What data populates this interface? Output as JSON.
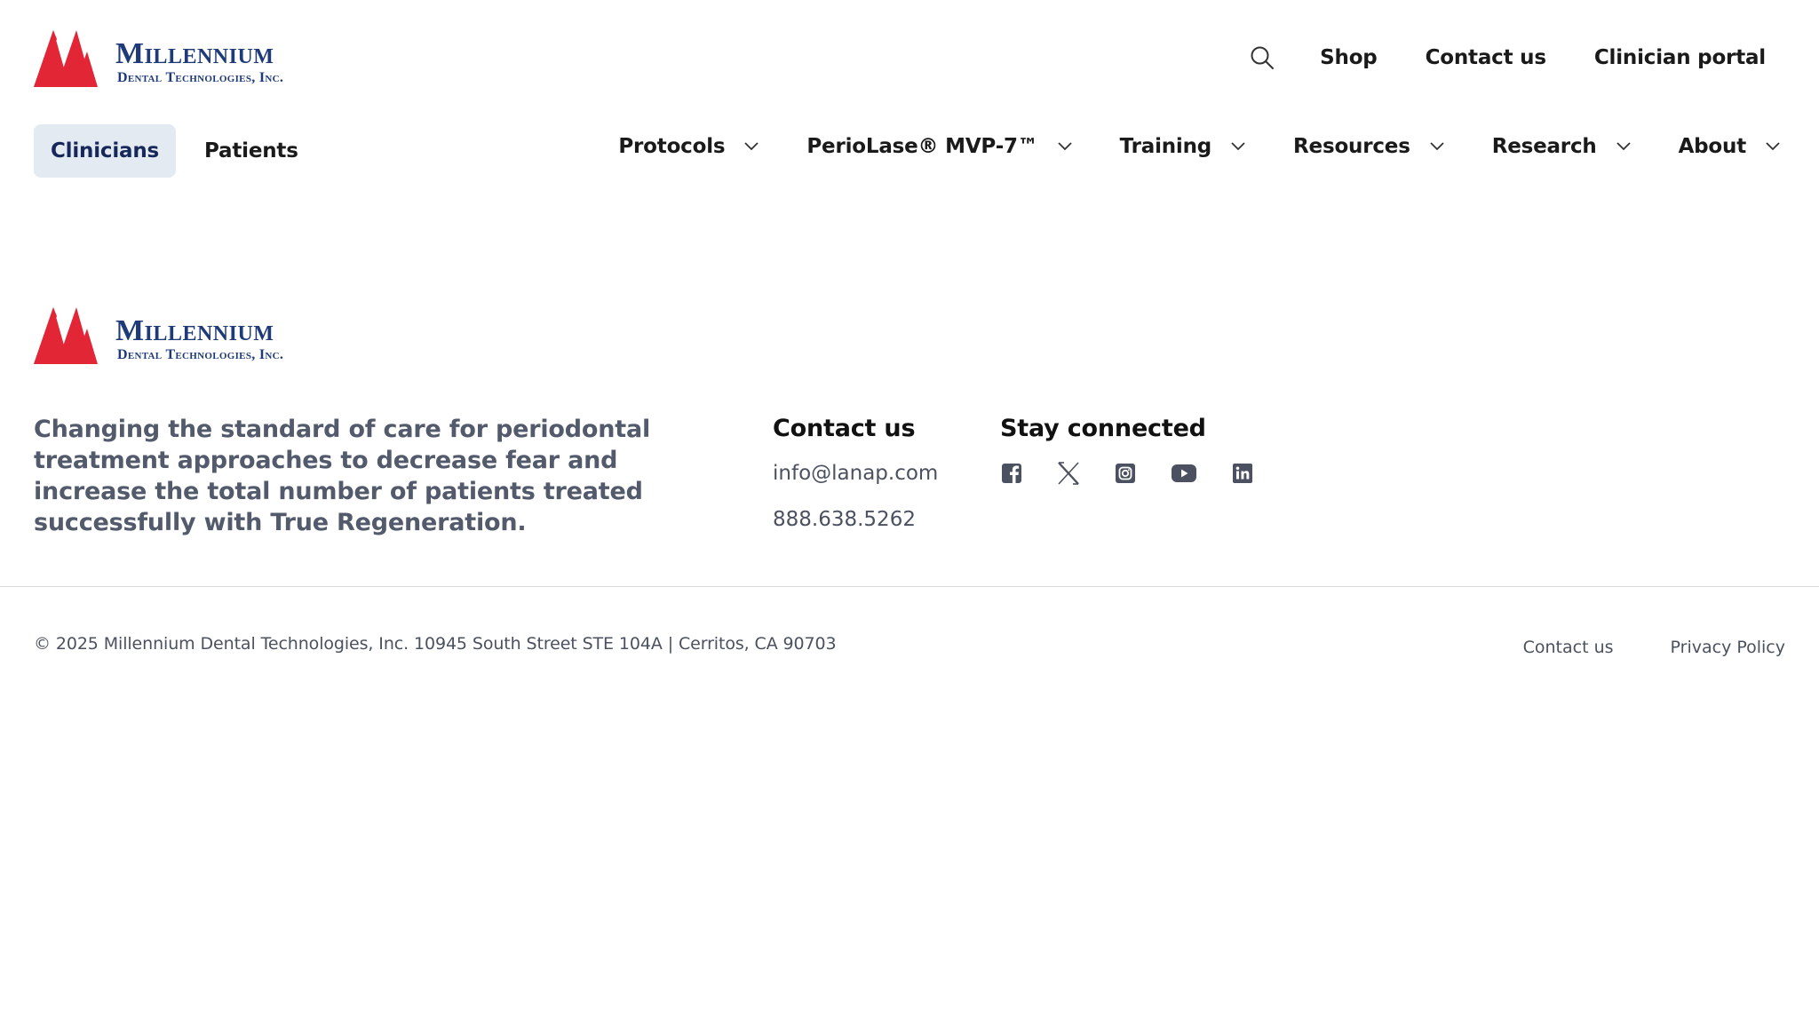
{
  "brand": {
    "wordmark_top": "Millennium",
    "wordmark_bottom": "Dental Technologies, Inc.",
    "logo_red": "#e32636",
    "logo_blue": "#1e3a78"
  },
  "utility_nav": {
    "search_icon": "search-icon",
    "links": [
      "Shop",
      "Contact us",
      "Clinician portal"
    ]
  },
  "audience_tabs": {
    "active": "Clinicians",
    "inactive": "Patients"
  },
  "main_nav": {
    "items": [
      "Protocols",
      "PerioLase® MVP-7™",
      "Training",
      "Resources",
      "Research",
      "About"
    ],
    "chevron_icon": "chevron-down-icon"
  },
  "footer": {
    "tagline": "Changing the standard of care for periodontal treatment approaches to decrease fear and increase the total number of patients treated successfully with True Regeneration.",
    "contact": {
      "title": "Contact us",
      "email": "info@lanap.com",
      "phone": "888.638.5262"
    },
    "social": {
      "title": "Stay connected",
      "icons": [
        "facebook-icon",
        "x-twitter-icon",
        "instagram-icon",
        "youtube-icon",
        "linkedin-icon"
      ]
    },
    "copyright": "© 2025 Millennium Dental Technologies, Inc. 10945 South Street STE 104A | Cerritos, CA 90703",
    "links": [
      "Contact us",
      "Privacy Policy"
    ]
  },
  "colors": {
    "active_tab_bg": "#e4eaf2",
    "active_tab_text": "#16285a",
    "muted_text": "#4b5160",
    "divider": "#d9dbe0"
  }
}
